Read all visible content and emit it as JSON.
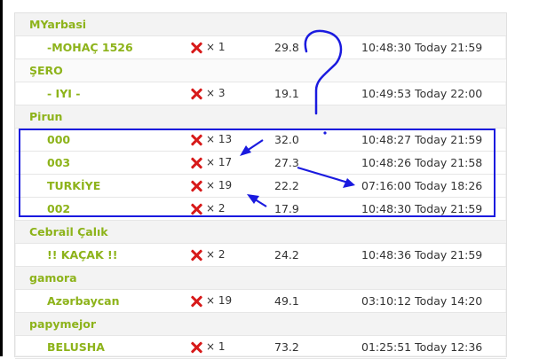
{
  "groups": [
    {
      "name": "MYarbasi",
      "items": [
        {
          "name": "-MOHAÇ 1526",
          "count": "× 1",
          "score": "29.8",
          "time": "10:48:30 Today 21:59"
        }
      ]
    },
    {
      "name": "ŞERO",
      "items": [
        {
          "name": "- IYI -",
          "count": "× 3",
          "score": "19.1",
          "time": "10:49:53 Today 22:00"
        }
      ]
    },
    {
      "name": "Pirun",
      "items": [
        {
          "name": "000",
          "count": "× 13",
          "score": "32.0",
          "time": "10:48:27 Today 21:59"
        },
        {
          "name": "003",
          "count": "× 17",
          "score": "27.3",
          "time": "10:48:26 Today 21:58"
        },
        {
          "name": "TURKİYE",
          "count": "× 19",
          "score": "22.2",
          "time": "07:16:00 Today 18:26"
        },
        {
          "name": "002",
          "count": "× 2",
          "score": "17.9",
          "time": "10:48:30 Today 21:59"
        }
      ]
    },
    {
      "name": "Cebrail Çalık",
      "items": [
        {
          "name": "!! KAÇAK !!",
          "count": "× 2",
          "score": "24.2",
          "time": "10:48:36 Today 21:59"
        }
      ]
    },
    {
      "name": "gamora",
      "items": [
        {
          "name": "Azərbaycan",
          "count": "× 19",
          "score": "49.1",
          "time": "03:10:12 Today 14:20"
        }
      ]
    },
    {
      "name": "papymejor",
      "items": [
        {
          "name": "BELUSHA",
          "count": "× 1",
          "score": "73.2",
          "time": "01:25:51 Today 12:36"
        }
      ]
    }
  ],
  "colors": {
    "group_text": "#8db31a",
    "x_icon": "#d71a1a",
    "annotation": "#1a1adf"
  },
  "icons": {
    "remove": "x-icon"
  },
  "annotations": {
    "question_mark": "?"
  }
}
